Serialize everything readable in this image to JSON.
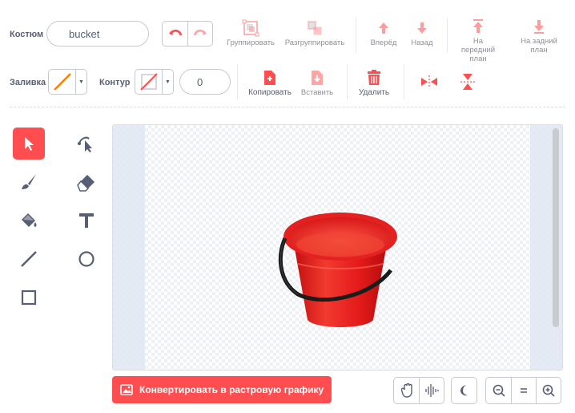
{
  "costume": {
    "label": "Костюм",
    "name_value": "bucket"
  },
  "toolbar": {
    "group": "Группировать",
    "ungroup": "Разгруппировать",
    "forward": "Вперёд",
    "backward": "Назад",
    "front": "На передний план",
    "back": "На задний план"
  },
  "fill": {
    "label": "Заливка"
  },
  "outline": {
    "label": "Контур",
    "width": "0"
  },
  "actions": {
    "copy": "Копировать",
    "paste": "Вставить",
    "delete": "Удалить"
  },
  "tools": [
    "select",
    "reshape",
    "brush",
    "eraser",
    "fill",
    "text",
    "line",
    "circle",
    "rectangle"
  ],
  "bottom": {
    "convert": "Конвертировать в растровую графику"
  },
  "colors": {
    "accent": "#ff4d50",
    "text": "#575e75",
    "bucket": "#e61e1e"
  }
}
